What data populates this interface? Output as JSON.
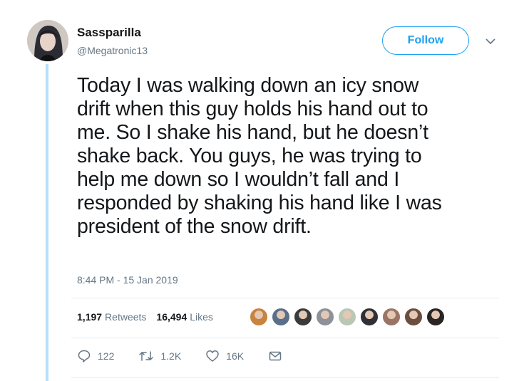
{
  "author": {
    "name": "Sassparilla",
    "handle": "@Megatronic13"
  },
  "follow_label": "Follow",
  "tweet": {
    "lines": [
      "Today I was walking down an icy snow",
      "drift when this guy holds his hand out to",
      "me. So I shake his hand, but he doesn’t",
      "shake back. You guys, he was trying to",
      "help me down so I wouldn’t fall and I",
      "responded by shaking his hand like I was",
      "president of the snow drift."
    ],
    "timestamp": "8:44 PM - 15 Jan 2019"
  },
  "stats": {
    "retweets_count": "1,197",
    "retweets_label": "Retweets",
    "likes_count": "16,494",
    "likes_label": "Likes"
  },
  "likers": [
    {
      "color": "#c8833e"
    },
    {
      "color": "#5a6f8a"
    },
    {
      "color": "#3b3b3b"
    },
    {
      "color": "#8d9198"
    },
    {
      "color": "#b9c7b4"
    },
    {
      "color": "#2f3134"
    },
    {
      "color": "#9a7566"
    },
    {
      "color": "#6b4e3f"
    },
    {
      "color": "#2a2422"
    }
  ],
  "actions": {
    "replies": "122",
    "retweets": "1.2K",
    "likes": "16K"
  },
  "colors": {
    "accent": "#1da1f2",
    "muted": "#657786",
    "thread_line": "#b7dffb"
  }
}
